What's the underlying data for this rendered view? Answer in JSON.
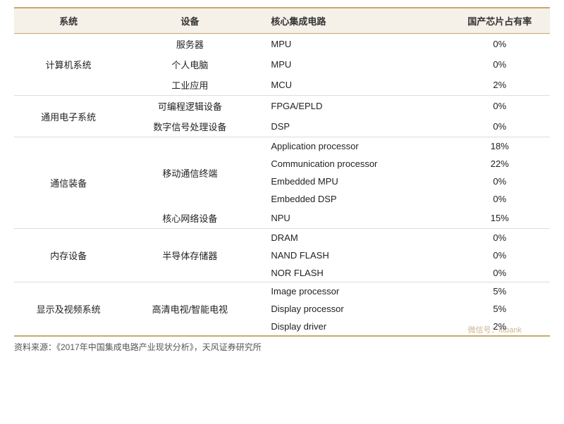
{
  "table": {
    "headers": [
      "系统",
      "设备",
      "核心集成电路",
      "国产芯片占有率"
    ],
    "rows": [
      {
        "system": "计算机系统",
        "device": "服务器",
        "chip": "MPU",
        "rate": "0%",
        "system_rowspan": 3,
        "device_rowspan": 1
      },
      {
        "system": "",
        "device": "个人电脑",
        "chip": "MPU",
        "rate": "0%"
      },
      {
        "system": "",
        "device": "工业应用",
        "chip": "MCU",
        "rate": "2%"
      },
      {
        "system": "通用电子系统",
        "device": "可编程逻辑设备",
        "chip": "FPGA/EPLD",
        "rate": "0%",
        "system_rowspan": 2
      },
      {
        "system": "",
        "device": "数字信号处理设备",
        "chip": "DSP",
        "rate": "0%"
      },
      {
        "system": "通信装备",
        "device": "移动通信终端",
        "chip": "Application processor",
        "rate": "18%",
        "system_rowspan": 6,
        "device_rowspan": 4
      },
      {
        "system": "",
        "device": "",
        "chip": "Communication processor",
        "rate": "22%"
      },
      {
        "system": "",
        "device": "",
        "chip": "Embedded MPU",
        "rate": "0%"
      },
      {
        "system": "",
        "device": "",
        "chip": "Embedded DSP",
        "rate": "0%"
      },
      {
        "system": "",
        "device": "核心网络设备",
        "chip": "NPU",
        "rate": "15%",
        "device_rowspan": 1
      },
      {
        "system": "内存设备",
        "device": "半导体存储器",
        "chip": "DRAM",
        "rate": "0%",
        "system_rowspan": 3,
        "device_rowspan": 3
      },
      {
        "system": "",
        "device": "",
        "chip": "NAND FLASH",
        "rate": "0%"
      },
      {
        "system": "",
        "device": "",
        "chip": "NOR FLASH",
        "rate": "0%"
      },
      {
        "system": "显示及视频系统",
        "device": "高清电视/智能电视",
        "chip": "Image processor",
        "rate": "5%",
        "system_rowspan": 3,
        "device_rowspan": 3
      },
      {
        "system": "",
        "device": "",
        "chip": "Display processor",
        "rate": "5%"
      },
      {
        "system": "",
        "device": "",
        "chip": "Display driver",
        "rate": "2%"
      }
    ]
  },
  "footer": "资料来源：《2017年中国集成电路产业现状分析》，天风证券研究所",
  "watermark": "微信号：ittbank"
}
